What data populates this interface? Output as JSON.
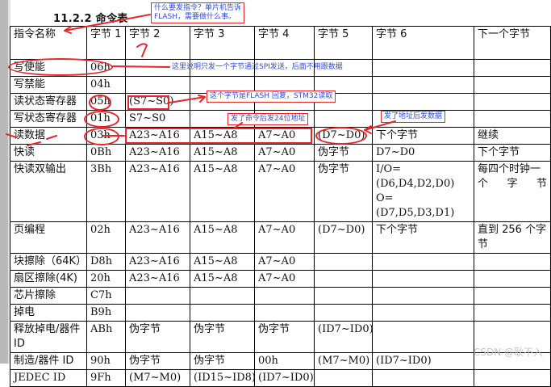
{
  "heading": "11.2.2 命令表",
  "table": {
    "headers": [
      "指令名称",
      "字节 1",
      "字节 2",
      "字节 3",
      "字节 4",
      "字节 5",
      "字节 6",
      "下一个字节"
    ],
    "rows": [
      [
        "写使能",
        "06h",
        "",
        "",
        "",
        "",
        "",
        ""
      ],
      [
        "写禁能",
        "04h",
        "",
        "",
        "",
        "",
        "",
        ""
      ],
      [
        "读状态寄存器",
        "05h",
        "(S7~S0)",
        "",
        "",
        "",
        "",
        ""
      ],
      [
        "写状态寄存器",
        "01h",
        "S7~S0",
        "",
        "",
        "",
        "",
        ""
      ],
      [
        "读数据",
        "03h",
        "A23~A16",
        "A15~A8",
        "A7~A0",
        "(D7~D0)",
        "下个字节",
        "继续"
      ],
      [
        "快读",
        "0Bh",
        "A23~A16",
        "A15~A8",
        "A7~A0",
        "伪字节",
        "D7~D0",
        "下个字节"
      ],
      [
        "快读双输出",
        "3Bh",
        "A23~A16",
        "A15~A8",
        "A7~A0",
        "伪字节",
        "I/O=(D6,D4,D2,D0) O=(D7,D5,D3,D1)",
        "每四个时钟一个字节"
      ],
      [
        "页编程",
        "02h",
        "A23~A16",
        "A15~A8",
        "A7~A0",
        "(D7~D0)",
        "下个字节",
        "直到 256 个字节"
      ],
      [
        "块擦除（64K）",
        "D8h",
        "A23~A16",
        "A15~A8",
        "A7~A0",
        "",
        "",
        ""
      ],
      [
        "扇区擦除(4K)",
        "20h",
        "A23~A16",
        "A15~A8",
        "A7~A0",
        "",
        "",
        ""
      ],
      [
        "芯片擦除",
        "C7h",
        "",
        "",
        "",
        "",
        "",
        ""
      ],
      [
        "掉电",
        "B9h",
        "",
        "",
        "",
        "",
        "",
        ""
      ],
      [
        "释放掉电/器件 ID",
        "ABh",
        "伪字节",
        "伪字节",
        "伪字节",
        "(ID7~ID0)",
        "",
        ""
      ],
      [
        "制造/器件 ID",
        "90h",
        "伪字节",
        "伪字节",
        "00h",
        "(M7~M0)",
        "(ID7~ID0)",
        ""
      ],
      [
        "JEDEC ID",
        "9Fh",
        "(M7~M0)",
        "(ID15~ID8)",
        "(ID7~ID0)",
        "",
        "",
        ""
      ]
    ]
  },
  "annotations": {
    "why_send": "什么要发指令？单片机告诉\nFLASH，需要做什么事。",
    "write_enable_note": "这里说明只发一个字节通过SPI发送，后面不用跟数据",
    "status_reply": "这个字节是FLASH 回复，STM32读取",
    "addr_24": "发了命令后发24位地址",
    "after_addr": "发了地址后发数据"
  },
  "watermark": "CSDN @耿不入",
  "colors": {
    "annotation_red": "#e8262a",
    "annotation_blue": "#2f4bd8"
  }
}
